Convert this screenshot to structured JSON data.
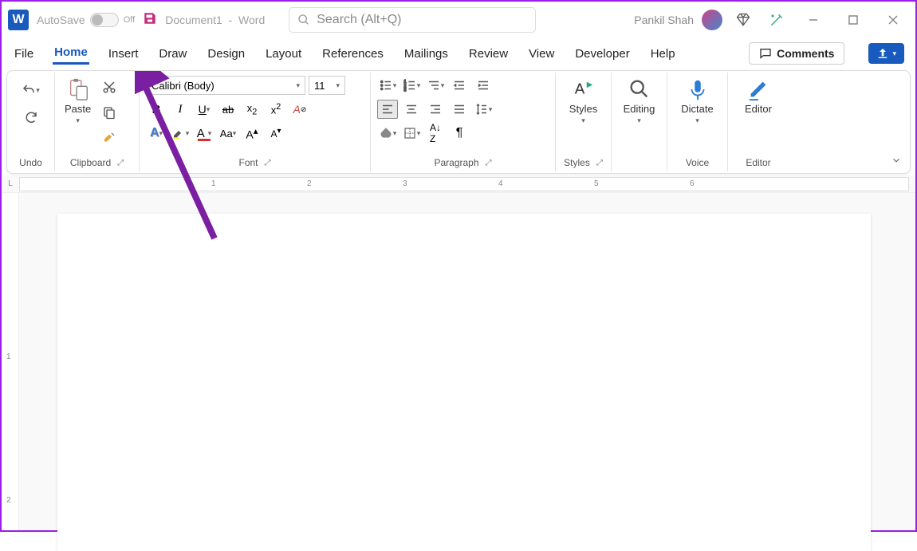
{
  "titlebar": {
    "autosave": "AutoSave",
    "autosave_state": "Off",
    "docname": "Document1",
    "appname": "Word",
    "search_placeholder": "Search (Alt+Q)",
    "username": "Pankil Shah"
  },
  "tabs": {
    "items": [
      "File",
      "Home",
      "Insert",
      "Draw",
      "Design",
      "Layout",
      "References",
      "Mailings",
      "Review",
      "View",
      "Developer",
      "Help"
    ],
    "active": "Home",
    "comments": "Comments"
  },
  "ribbon": {
    "undo_label": "Undo",
    "clipboard_label": "Clipboard",
    "paste": "Paste",
    "font_label": "Font",
    "font_name": "Calibri (Body)",
    "font_size": "11",
    "paragraph_label": "Paragraph",
    "styles_label": "Styles",
    "styles": "Styles",
    "editing": "Editing",
    "dictate": "Dictate",
    "voice_label": "Voice",
    "editor": "Editor",
    "editor_label": "Editor"
  },
  "ruler": {
    "numbers": [
      "1",
      "2",
      "3",
      "4",
      "5",
      "6"
    ]
  },
  "vruler": {
    "numbers": [
      "1",
      "2"
    ]
  }
}
